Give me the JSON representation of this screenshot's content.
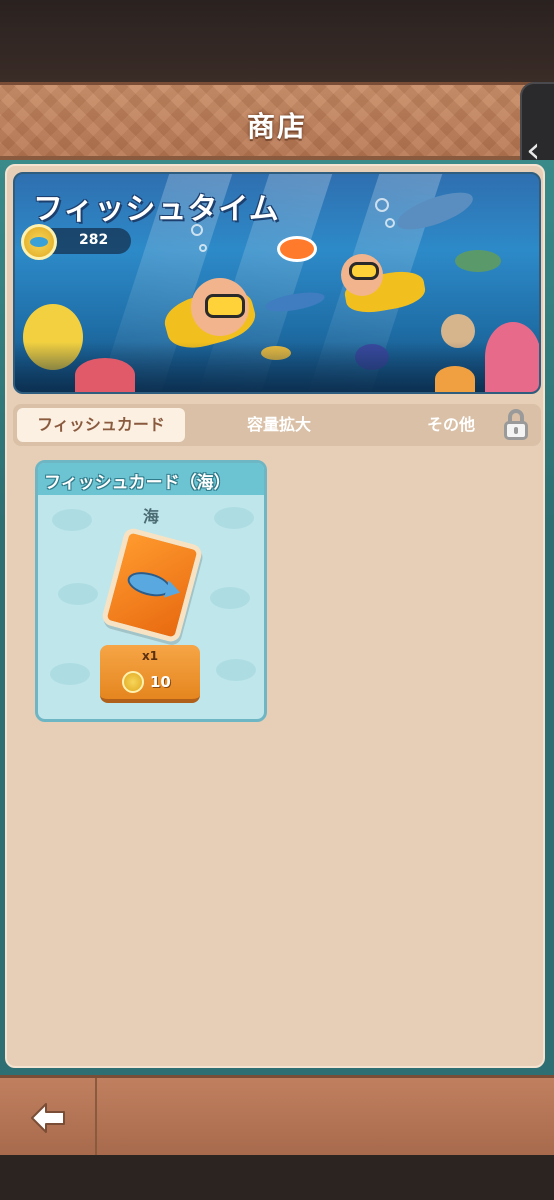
{
  "header": {
    "title": "商店"
  },
  "banner": {
    "title": "フィッシュタイム",
    "coin_count": "282"
  },
  "tabs": [
    {
      "label": "フィッシュカード",
      "active": true
    },
    {
      "label": "容量拡大",
      "active": false
    },
    {
      "label": "その他",
      "active": false,
      "locked": true
    }
  ],
  "products": [
    {
      "title": "フィッシュカード（海）",
      "subtitle": "海",
      "quantity": "x1",
      "price": "10"
    }
  ],
  "colors": {
    "header": "#b87752",
    "panel": "#e6cfb6",
    "accent_button": "#e5861f",
    "card_title_bar": "#6cc3d2"
  },
  "icons": [
    "chevron-left-icon",
    "coin-icon",
    "lock-icon",
    "fish-card-icon",
    "back-arrow-icon"
  ]
}
